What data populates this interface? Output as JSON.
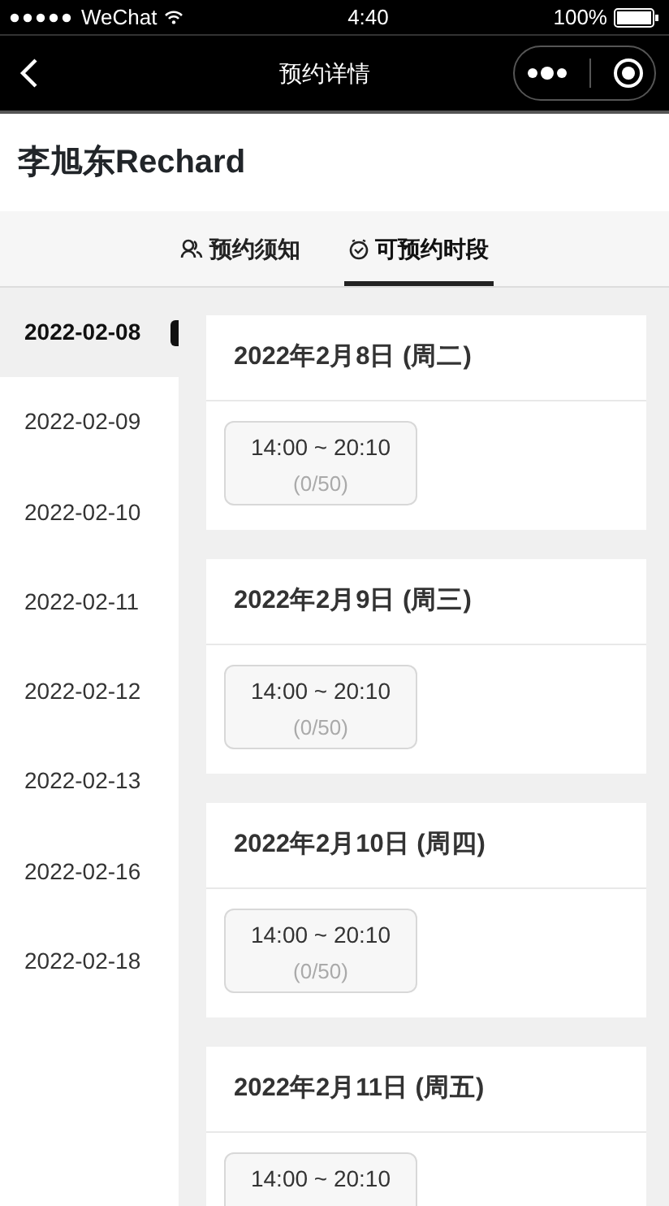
{
  "status_bar": {
    "carrier": "WeChat",
    "time": "4:40",
    "battery": "100%"
  },
  "nav": {
    "title": "预约详情"
  },
  "doctor": {
    "name": "李旭东Rechard"
  },
  "tabs": [
    {
      "label": "预约须知",
      "kind": "people",
      "selected": false
    },
    {
      "label": "可预约时段",
      "kind": "clock",
      "selected": true
    }
  ],
  "dates": [
    {
      "label": "2022-02-08",
      "selected": true
    },
    {
      "label": "2022-02-09",
      "selected": false
    },
    {
      "label": "2022-02-10",
      "selected": false
    },
    {
      "label": "2022-02-11",
      "selected": false
    },
    {
      "label": "2022-02-12",
      "selected": false
    },
    {
      "label": "2022-02-13",
      "selected": false
    },
    {
      "label": "2022-02-16",
      "selected": false
    },
    {
      "label": "2022-02-18",
      "selected": false
    }
  ],
  "days": [
    {
      "title": "2022年2月8日 (周二)",
      "slots": [
        {
          "time": "14:00 ~ 20:10",
          "count": "(0/50)"
        }
      ]
    },
    {
      "title": "2022年2月9日 (周三)",
      "slots": [
        {
          "time": "14:00 ~ 20:10",
          "count": "(0/50)"
        }
      ]
    },
    {
      "title": "2022年2月10日 (周四)",
      "slots": [
        {
          "time": "14:00 ~ 20:10",
          "count": "(0/50)"
        }
      ]
    },
    {
      "title": "2022年2月11日 (周五)",
      "slots": [
        {
          "time": "14:00 ~ 20:10"
        }
      ]
    }
  ]
}
